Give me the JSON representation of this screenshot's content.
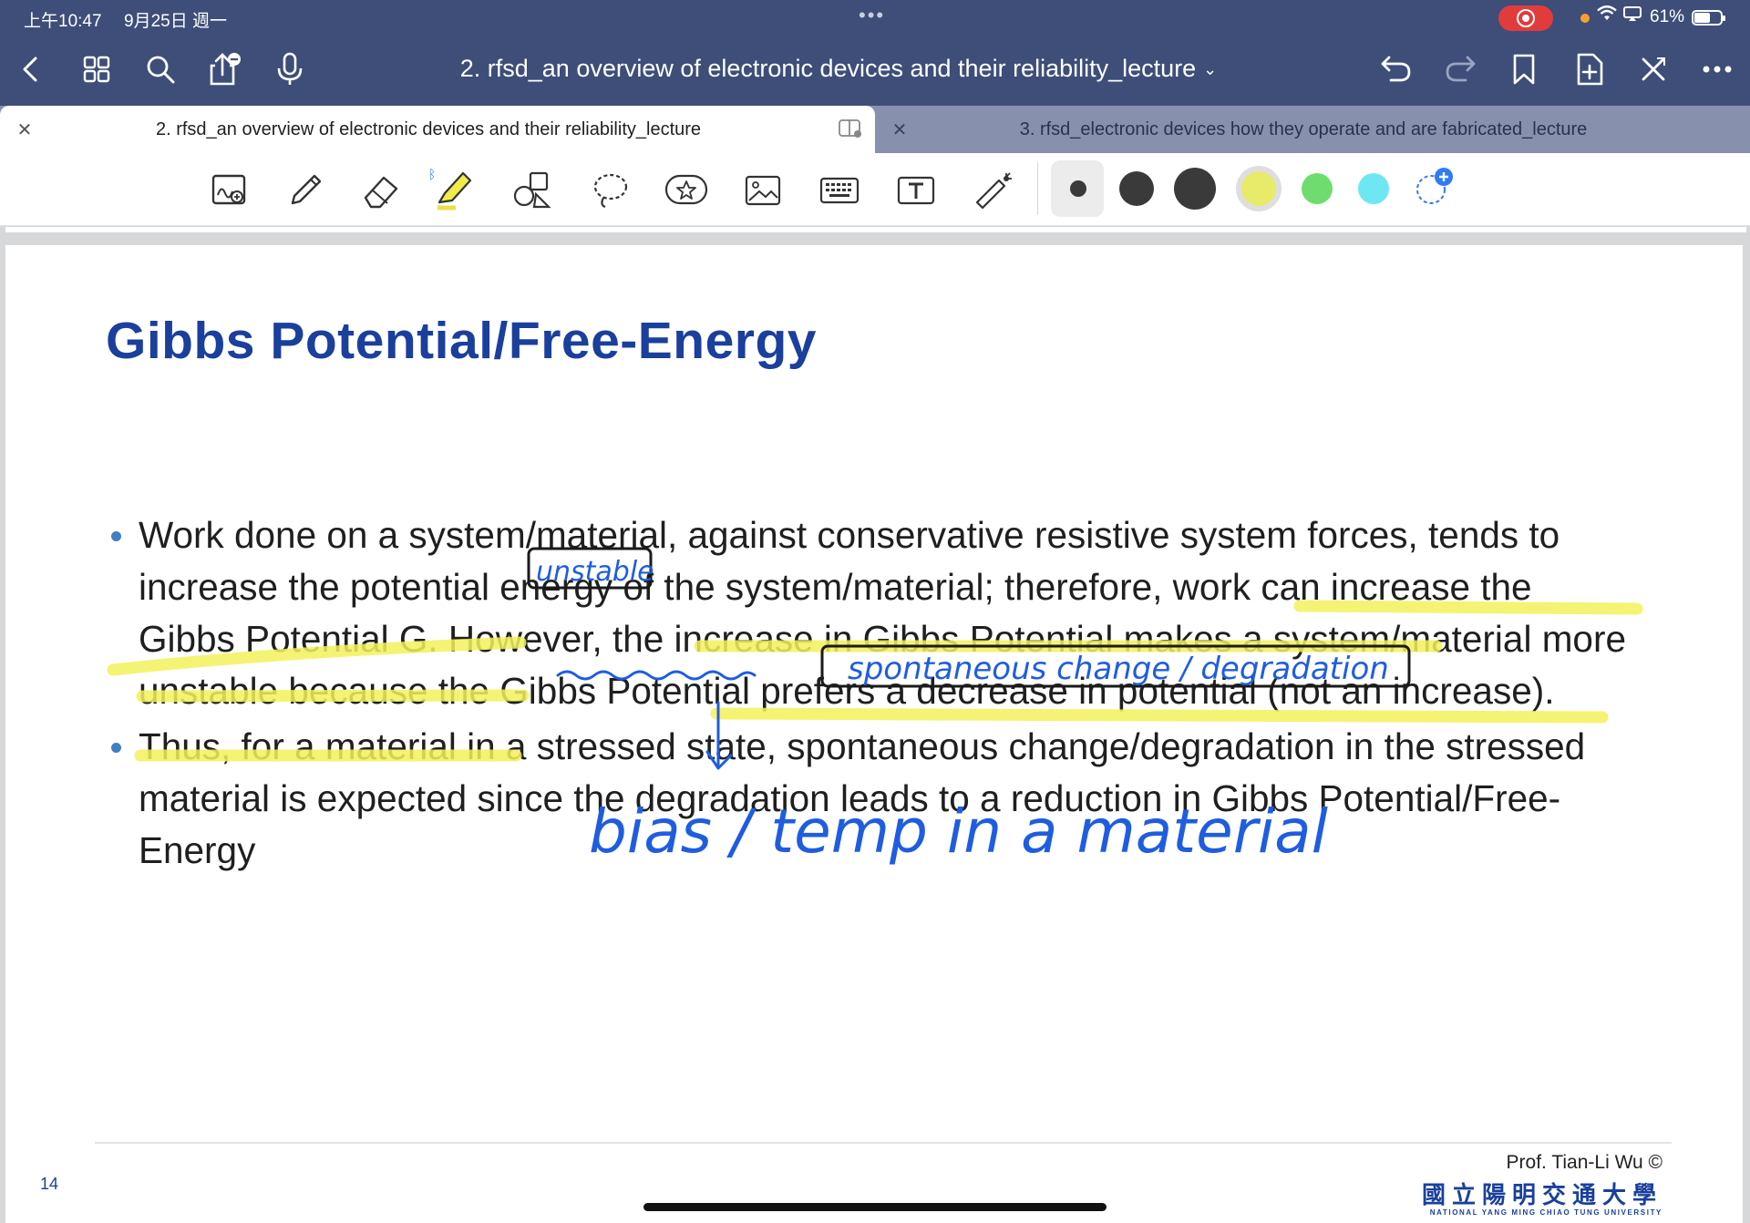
{
  "status_bar": {
    "time": "上午10:47",
    "date": "9月25日 週一",
    "battery_text": "61%",
    "battery_level": 0.61
  },
  "header": {
    "title": "2. rfsd_an overview of electronic devices and their reliability_lecture",
    "title_chevron": "⌄"
  },
  "tabs": [
    {
      "label": "2. rfsd_an overview of electronic devices and their reliability_lecture",
      "active": true
    },
    {
      "label": "3. rfsd_electronic devices how they operate and are fabricated_lecture",
      "active": false
    }
  ],
  "toolbar": {
    "tools": [
      "zoom-box-icon",
      "pen-icon",
      "eraser-icon",
      "highlighter-icon",
      "shapes-icon",
      "lasso-icon",
      "sticker-icon",
      "image-icon",
      "keyboard-icon",
      "text-box-icon",
      "laser-pointer-icon"
    ],
    "colors": {
      "swatch_1": "#3a3a3a",
      "swatch_2": "#3a3a3a",
      "swatch_3": "#3a3a3a",
      "swatch_4": "#e8ea6a",
      "swatch_5": "#6fdc6f",
      "swatch_6": "#6fe7f2",
      "add_color": "#2f7bf5"
    }
  },
  "slide": {
    "title": "Gibbs Potential/Free-Energy",
    "bullet_1": "Work done on a system/material, against conservative resistive system forces, tends to increase the potential energy of the system/material; therefore, work can increase the Gibbs Potential G. However, the increase in Gibbs Potential makes a system/material more unstable because the Gibbs Potential prefers a decrease in potential (not an increase).",
    "bullet_2": "Thus, for a material in a stressed state, spontaneous change/degradation in the stressed material is expected since the degradation leads to a reduction in Gibbs Potential/Free-Energy",
    "page_number": "14",
    "credit": "Prof. Tian-Li Wu ©",
    "university": "國立陽明交通大學",
    "university_en": "NATIONAL YANG MING CHIAO TUNG UNIVERSITY"
  },
  "annotations": {
    "handwriting_1": "unstable",
    "handwriting_2": "spontaneous change / degradation",
    "handwriting_3": "bias / temp in a material"
  },
  "colors": {
    "header_bg": "#3e4e79",
    "title_blue": "#1a3f9c",
    "highlight_yellow": "#f3f15a",
    "ink_blue": "#1f5de0"
  }
}
